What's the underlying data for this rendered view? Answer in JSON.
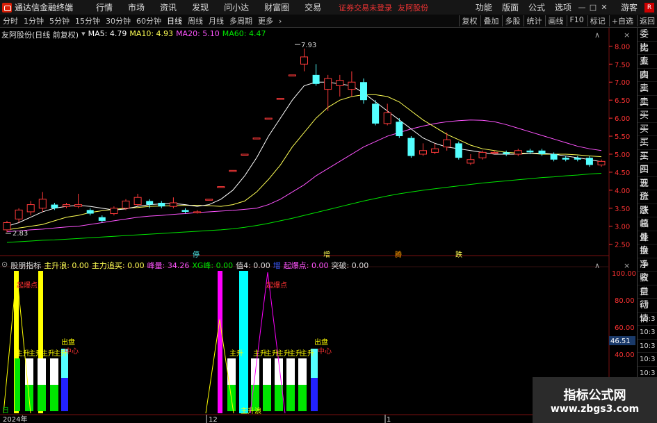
{
  "titlebar": {
    "app_title": "通达信金融终端",
    "menus": [
      "行情",
      "市场",
      "资讯",
      "发现",
      "问小达",
      "财富圈",
      "交易"
    ],
    "notice": "证券交易未登录",
    "stock": "友阿股份",
    "right": [
      "功能",
      "版面",
      "公式",
      "选项"
    ],
    "guest": "游客",
    "badge": "R"
  },
  "toolbar": {
    "periods": [
      "分时",
      "1分钟",
      "5分钟",
      "15分钟",
      "30分钟",
      "60分钟",
      "日线",
      "周线",
      "月线",
      "多周期",
      "更多"
    ],
    "right": [
      "复权",
      "叠加",
      "多股",
      "统计",
      "画线",
      "F10",
      "标记",
      "+自选",
      "返回"
    ]
  },
  "main_legend": {
    "name": "友阿股份(日线 前复权)",
    "ma5": "MA5: 4.79",
    "ma10": "MA10: 4.93",
    "ma20": "MA20: 5.10",
    "ma60": "MA60: 4.47"
  },
  "indicator_legend": {
    "name": "股朋指标",
    "a": "主升浪: 0.00",
    "b": "主力追买: 0.00",
    "c": "峰量: 34.26",
    "d": "XG峰: 0.00",
    "e": "值4: 0.00",
    "f": "增",
    "g": "起爆点: 0.00",
    "h": "突破: 0.00"
  },
  "price_axis": [
    "8.00",
    "7.50",
    "7.00",
    "6.50",
    "6.00",
    "5.50",
    "5.00",
    "4.50",
    "4.00",
    "3.50",
    "3.00",
    "2.50"
  ],
  "indicator_axis": [
    "100.00",
    "80.00",
    "60.00",
    "40.00"
  ],
  "indicator_current": "46.51",
  "annotations": {
    "high": "7.93",
    "low": "2.83",
    "mark1": "停",
    "mark2": "增",
    "mark3": "腾",
    "mark4": "跌"
  },
  "indicator_labels": {
    "qibao": "起爆点",
    "zhusheng": "主升",
    "chupan": "出盘",
    "zhongxin": "中心",
    "zhushenglang": "主升浪",
    "bottom_left": "日",
    "date1": "2024年",
    "date2": "12",
    "date3": "1"
  },
  "sidebar": [
    "委比",
    "卖五",
    "卖四",
    "卖三",
    "卖二",
    "卖一",
    "买一",
    "买二",
    "买三",
    "买四",
    "买五",
    "现价",
    "涨跌",
    "涨幅",
    "总量",
    "外盘",
    "换手",
    "净资",
    "收益",
    "自动",
    "行情",
    "10:3",
    "10:3",
    "10:3",
    "10:3",
    "10:3",
    "10:3",
    "10:3",
    "10:3",
    "10:3"
  ],
  "watermark": {
    "title": "指标公式网",
    "url": "www.zbgs3.com"
  },
  "colors": {
    "up": "#ff3a3a",
    "down": "#54ffff",
    "ma5": "#ffffff",
    "ma10": "#ffff54",
    "ma20": "#ff54ff",
    "ma60": "#00e600"
  },
  "chart_data": {
    "type": "candlestick",
    "ylim": [
      2.3,
      8.2
    ],
    "candles": [
      {
        "o": 2.9,
        "c": 3.1,
        "h": 3.15,
        "l": 2.83
      },
      {
        "o": 3.2,
        "c": 3.45,
        "h": 3.5,
        "l": 3.1
      },
      {
        "o": 3.4,
        "c": 3.6,
        "h": 3.7,
        "l": 3.3
      },
      {
        "o": 3.5,
        "c": 3.75,
        "h": 3.95,
        "l": 3.4
      },
      {
        "o": 3.6,
        "c": 3.5,
        "h": 3.65,
        "l": 3.45
      },
      {
        "o": 3.55,
        "c": 3.6,
        "h": 3.65,
        "l": 3.5
      },
      {
        "o": 3.55,
        "c": 3.6,
        "h": 3.9,
        "l": 3.5
      },
      {
        "o": 3.45,
        "c": 3.35,
        "h": 3.5,
        "l": 3.3
      },
      {
        "o": 3.25,
        "c": 3.15,
        "h": 3.3,
        "l": 3.1
      },
      {
        "o": 3.35,
        "c": 3.5,
        "h": 3.55,
        "l": 3.3
      },
      {
        "o": 3.5,
        "c": 3.7,
        "h": 3.75,
        "l": 3.45
      },
      {
        "o": 3.6,
        "c": 3.8,
        "h": 3.9,
        "l": 3.55
      },
      {
        "o": 3.7,
        "c": 3.6,
        "h": 3.75,
        "l": 3.5
      },
      {
        "o": 3.65,
        "c": 3.55,
        "h": 3.7,
        "l": 3.5
      },
      {
        "o": 3.55,
        "c": 3.65,
        "h": 3.8,
        "l": 3.5
      },
      {
        "o": 3.45,
        "c": 3.4,
        "h": 3.5,
        "l": 3.35
      },
      {
        "o": 3.4,
        "c": 3.4,
        "h": 3.45,
        "l": 3.35
      },
      {
        "o": 3.75,
        "c": 3.75,
        "h": 3.75,
        "l": 3.75
      },
      {
        "o": 4.1,
        "c": 4.1,
        "h": 4.1,
        "l": 4.1
      },
      {
        "o": 4.55,
        "c": 4.55,
        "h": 4.55,
        "l": 4.55
      },
      {
        "o": 5.0,
        "c": 5.0,
        "h": 5.0,
        "l": 5.0
      },
      {
        "o": 5.45,
        "c": 5.45,
        "h": 5.45,
        "l": 5.45
      },
      {
        "o": 6.0,
        "c": 6.0,
        "h": 6.0,
        "l": 6.0
      },
      {
        "o": 6.55,
        "c": 6.55,
        "h": 6.55,
        "l": 6.55
      },
      {
        "o": 7.2,
        "c": 7.2,
        "h": 7.2,
        "l": 7.2
      },
      {
        "o": 7.5,
        "c": 7.7,
        "h": 7.93,
        "l": 7.3
      },
      {
        "o": 7.2,
        "c": 6.95,
        "h": 7.5,
        "l": 6.9
      },
      {
        "o": 6.8,
        "c": 7.1,
        "h": 7.2,
        "l": 6.2
      },
      {
        "o": 6.9,
        "c": 7.05,
        "h": 7.2,
        "l": 6.6
      },
      {
        "o": 6.8,
        "c": 7.0,
        "h": 7.3,
        "l": 6.6
      },
      {
        "o": 7.0,
        "c": 6.5,
        "h": 7.1,
        "l": 6.4
      },
      {
        "o": 6.4,
        "c": 5.85,
        "h": 6.5,
        "l": 5.8
      },
      {
        "o": 5.85,
        "c": 6.15,
        "h": 6.4,
        "l": 5.8
      },
      {
        "o": 5.9,
        "c": 5.5,
        "h": 6.0,
        "l": 5.45
      },
      {
        "o": 5.45,
        "c": 4.95,
        "h": 5.5,
        "l": 4.9
      },
      {
        "o": 5.0,
        "c": 5.1,
        "h": 5.3,
        "l": 4.95
      },
      {
        "o": 5.05,
        "c": 5.15,
        "h": 5.3,
        "l": 5.0
      },
      {
        "o": 5.2,
        "c": 5.4,
        "h": 5.6,
        "l": 5.1
      },
      {
        "o": 5.3,
        "c": 4.9,
        "h": 5.35,
        "l": 4.85
      },
      {
        "o": 4.75,
        "c": 4.85,
        "h": 5.0,
        "l": 4.7
      },
      {
        "o": 4.9,
        "c": 5.05,
        "h": 5.1,
        "l": 4.85
      },
      {
        "o": 5.05,
        "c": 5.05,
        "h": 5.1,
        "l": 5.0
      },
      {
        "o": 5.05,
        "c": 5.0,
        "h": 5.1,
        "l": 4.95
      },
      {
        "o": 5.0,
        "c": 5.1,
        "h": 5.15,
        "l": 4.95
      },
      {
        "o": 5.1,
        "c": 5.05,
        "h": 5.15,
        "l": 5.0
      },
      {
        "o": 5.1,
        "c": 5.0,
        "h": 5.15,
        "l": 4.95
      },
      {
        "o": 5.0,
        "c": 4.85,
        "h": 5.05,
        "l": 4.8
      },
      {
        "o": 4.9,
        "c": 4.85,
        "h": 4.95,
        "l": 4.8
      },
      {
        "o": 4.9,
        "c": 4.85,
        "h": 4.95,
        "l": 4.8
      },
      {
        "o": 4.9,
        "c": 4.7,
        "h": 4.95,
        "l": 4.65
      },
      {
        "o": 4.7,
        "c": 4.8,
        "h": 4.85,
        "l": 4.65
      }
    ],
    "ma5": [
      3.0,
      3.1,
      3.25,
      3.4,
      3.5,
      3.55,
      3.58,
      3.55,
      3.5,
      3.45,
      3.48,
      3.55,
      3.6,
      3.62,
      3.63,
      3.6,
      3.55,
      3.6,
      3.75,
      4.0,
      4.4,
      4.9,
      5.5,
      6.0,
      6.5,
      6.9,
      7.0,
      7.0,
      6.95,
      6.9,
      6.7,
      6.45,
      6.2,
      5.95,
      5.7,
      5.45,
      5.3,
      5.2,
      5.15,
      5.1,
      5.05,
      5.0,
      5.0,
      5.0,
      5.02,
      5.03,
      5.0,
      4.95,
      4.9,
      4.85,
      4.79
    ],
    "ma10": [
      2.9,
      2.95,
      3.0,
      3.05,
      3.15,
      3.25,
      3.3,
      3.38,
      3.43,
      3.47,
      3.5,
      3.52,
      3.55,
      3.56,
      3.57,
      3.58,
      3.58,
      3.57,
      3.55,
      3.6,
      3.7,
      3.95,
      4.3,
      4.7,
      5.2,
      5.6,
      6.0,
      6.3,
      6.5,
      6.6,
      6.65,
      6.65,
      6.6,
      6.45,
      6.2,
      5.95,
      5.75,
      5.55,
      5.4,
      5.25,
      5.15,
      5.1,
      5.05,
      5.03,
      5.02,
      5.0,
      5.0,
      5.0,
      4.98,
      4.95,
      4.93
    ],
    "ma20": [
      2.85,
      2.87,
      2.9,
      2.92,
      2.95,
      2.98,
      3.0,
      3.05,
      3.1,
      3.15,
      3.2,
      3.25,
      3.28,
      3.3,
      3.33,
      3.35,
      3.38,
      3.4,
      3.42,
      3.44,
      3.47,
      3.5,
      3.6,
      3.75,
      3.95,
      4.15,
      4.4,
      4.6,
      4.8,
      5.0,
      5.2,
      5.35,
      5.5,
      5.6,
      5.7,
      5.78,
      5.85,
      5.9,
      5.93,
      5.95,
      5.94,
      5.9,
      5.82,
      5.72,
      5.62,
      5.52,
      5.42,
      5.32,
      5.22,
      5.15,
      5.1
    ],
    "ma60": [
      2.55,
      2.57,
      2.59,
      2.61,
      2.62,
      2.64,
      2.66,
      2.68,
      2.7,
      2.72,
      2.74,
      2.76,
      2.78,
      2.8,
      2.82,
      2.84,
      2.86,
      2.88,
      2.9,
      2.93,
      2.97,
      3.02,
      3.08,
      3.15,
      3.22,
      3.3,
      3.38,
      3.46,
      3.54,
      3.62,
      3.7,
      3.77,
      3.84,
      3.9,
      3.95,
      4.0,
      4.04,
      4.08,
      4.12,
      4.16,
      4.2,
      4.23,
      4.26,
      4.29,
      4.32,
      4.35,
      4.37,
      4.4,
      4.42,
      4.45,
      4.47
    ]
  }
}
